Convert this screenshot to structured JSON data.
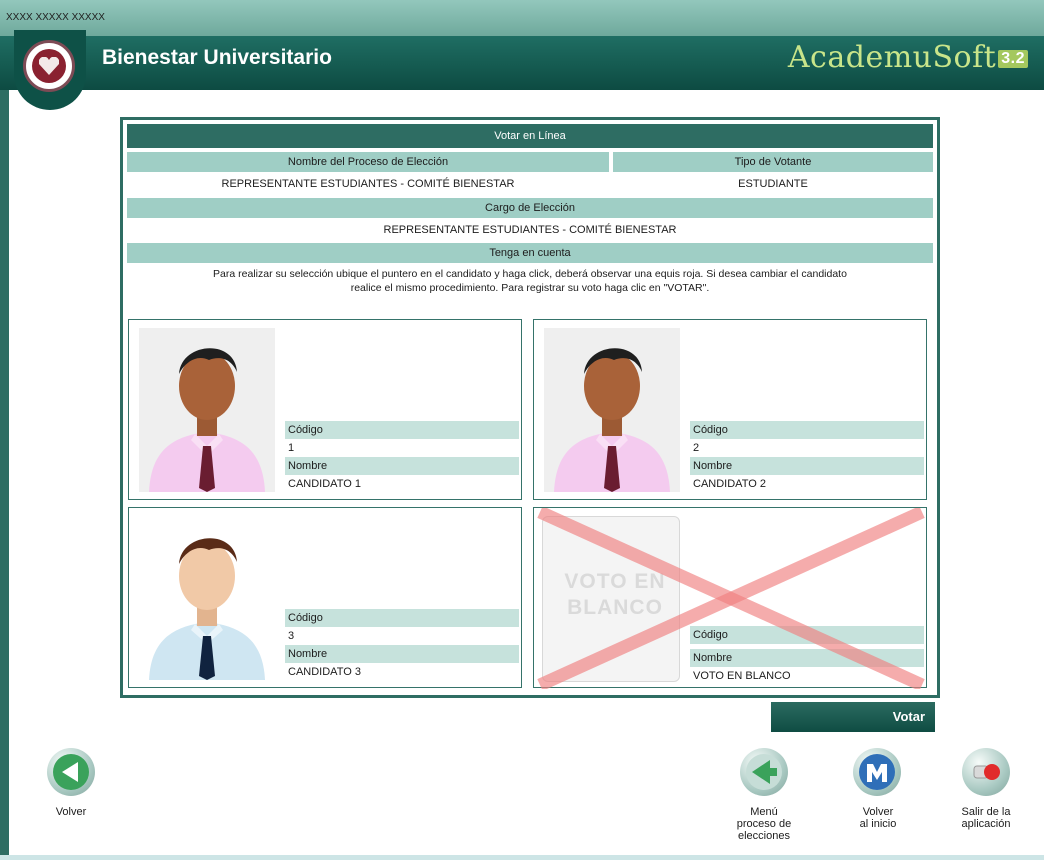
{
  "window": {
    "code": "XXXX XXXXX XXXXX"
  },
  "header": {
    "title": "Bienestar Universitario",
    "brand": "AcademuSoft",
    "brand_version": "3.2"
  },
  "panel": {
    "title": "Votar en Línea",
    "process_header": "Nombre del Proceso de Elección",
    "voter_type_header": "Tipo de Votante",
    "process_value": "REPRESENTANTE ESTUDIANTES - COMITÉ BIENESTAR",
    "voter_type_value": "ESTUDIANTE",
    "position_header": "Cargo de Elección",
    "position_value": "REPRESENTANTE ESTUDIANTES - COMITÉ BIENESTAR",
    "notice_header": "Tenga en cuenta",
    "notice_line1": "Para realizar su selección ubique el puntero en el candidato y haga click, deberá observar una equis roja. Si desea cambiar el candidato",
    "notice_line2": "realice el mismo procedimiento. Para registrar su voto haga clic en \"VOTAR\"."
  },
  "candidates": [
    {
      "code_label": "Código",
      "code": "1",
      "name_label": "Nombre",
      "name": "CANDIDATO 1"
    },
    {
      "code_label": "Código",
      "code": "2",
      "name_label": "Nombre",
      "name": "CANDIDATO 2"
    },
    {
      "code_label": "Código",
      "code": "3",
      "name_label": "Nombre",
      "name": "CANDIDATO 3"
    }
  ],
  "blank_vote": {
    "image_text_line1": "VOTO EN",
    "image_text_line2": "BLANCO",
    "code_label": "Código",
    "name_label": "Nombre",
    "name": "VOTO EN BLANCO",
    "selected": true
  },
  "actions": {
    "vote_label": "Votar"
  },
  "nav": {
    "back": "Volver",
    "menu": [
      "Menú",
      "proceso de",
      "elecciones"
    ],
    "home": [
      "Volver",
      "al inicio"
    ],
    "exit": [
      "Salir de la",
      "aplicación"
    ]
  },
  "colors": {
    "header_dark": "#0d4b42",
    "accent_teal": "#2e6d63",
    "sub_header": "#9fcec5",
    "selection_x": "#f08080"
  }
}
